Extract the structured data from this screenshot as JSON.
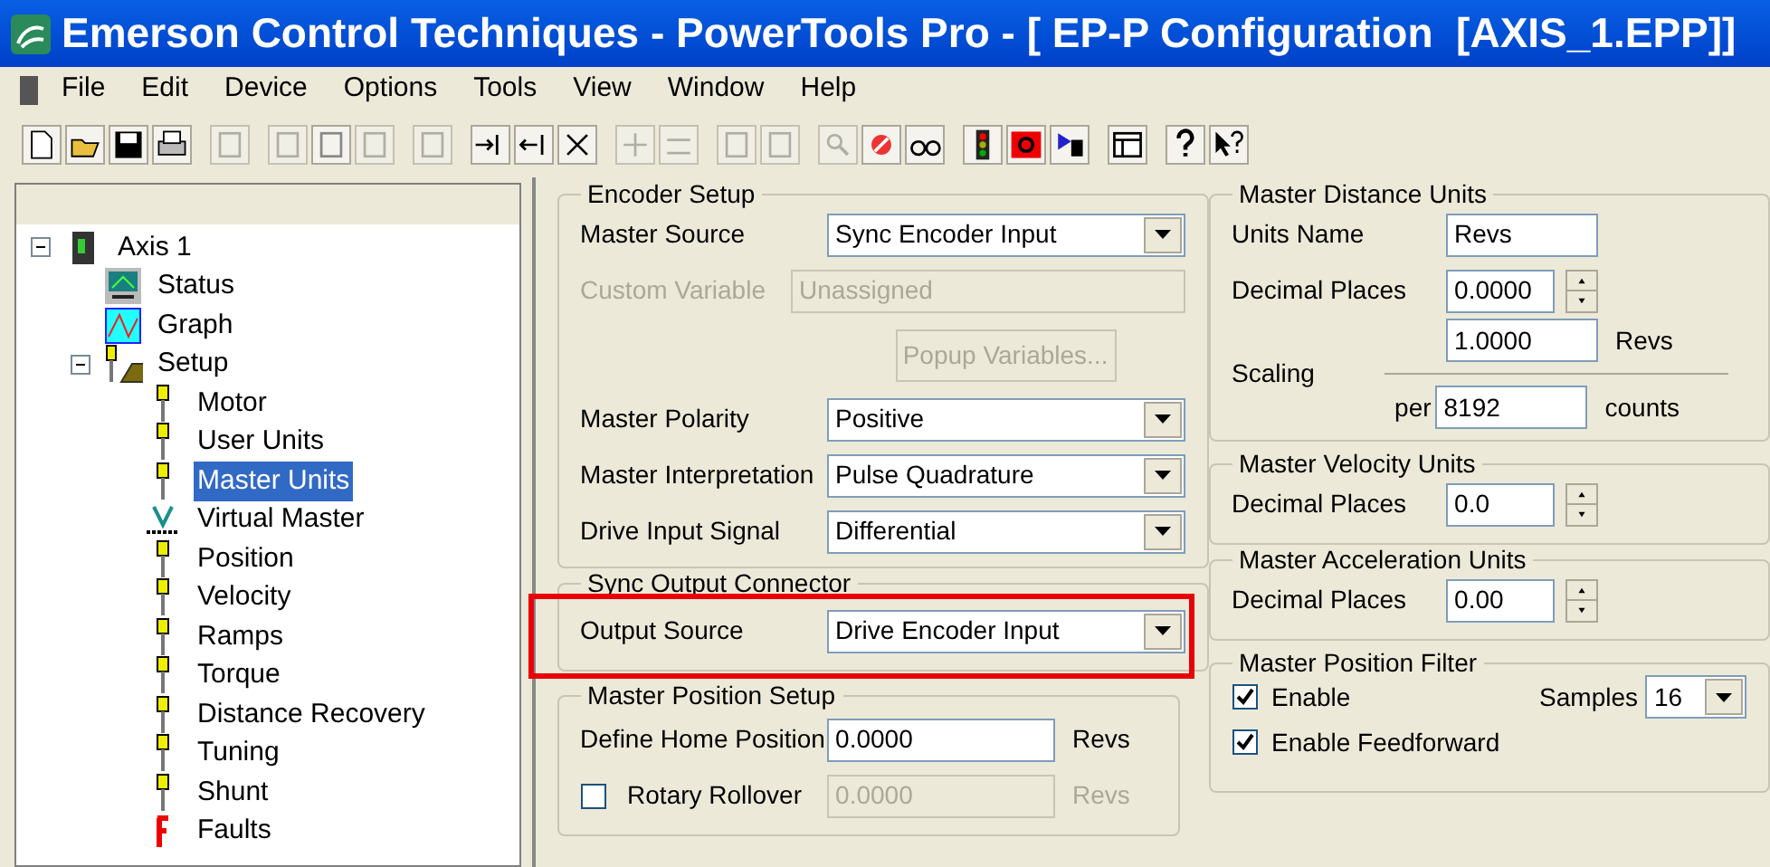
{
  "window": {
    "title": "Emerson Control Techniques - PowerTools Pro - [ EP-P Configuration  [AXIS_1.EPP]]"
  },
  "menu": [
    "File",
    "Edit",
    "Device",
    "Options",
    "Tools",
    "View",
    "Window",
    "Help"
  ],
  "tree": {
    "label": "Axis 1",
    "kind": "drive",
    "expanded": true,
    "selected": false,
    "children": [
      {
        "label": "Status",
        "kind": "status",
        "selected": false
      },
      {
        "label": "Graph",
        "kind": "graph",
        "selected": false
      },
      {
        "label": "Setup",
        "kind": "setup",
        "expanded": true,
        "selected": false,
        "children": [
          {
            "label": "Motor",
            "kind": "param",
            "selected": false
          },
          {
            "label": "User Units",
            "kind": "param",
            "selected": false
          },
          {
            "label": "Master Units",
            "kind": "param",
            "selected": true
          },
          {
            "label": "Virtual Master",
            "kind": "virtual",
            "selected": false
          },
          {
            "label": "Position",
            "kind": "param",
            "selected": false
          },
          {
            "label": "Velocity",
            "kind": "param",
            "selected": false
          },
          {
            "label": "Ramps",
            "kind": "param",
            "selected": false
          },
          {
            "label": "Torque",
            "kind": "param",
            "selected": false
          },
          {
            "label": "Distance Recovery",
            "kind": "param",
            "selected": false
          },
          {
            "label": "Tuning",
            "kind": "param",
            "selected": false
          },
          {
            "label": "Shunt",
            "kind": "param",
            "selected": false
          },
          {
            "label": "Faults",
            "kind": "fault",
            "selected": false
          }
        ]
      }
    ]
  },
  "encoder_setup": {
    "title": "Encoder Setup",
    "rows": [
      {
        "kind": "dropdown",
        "label": "Master Source",
        "value": "Sync Encoder Input",
        "disabled": false
      },
      {
        "kind": "text",
        "label": "Custom Variable",
        "value": "Unassigned",
        "disabled": true
      },
      {
        "kind": "button",
        "label": "Popup Variables...",
        "disabled": true
      },
      {
        "kind": "dropdown",
        "label": "Master Polarity",
        "value": "Positive",
        "disabled": false
      },
      {
        "kind": "dropdown",
        "label": "Master Interpretation",
        "value": "Pulse Quadrature",
        "disabled": false
      },
      {
        "kind": "dropdown",
        "label": "Drive Input Signal",
        "value": "Differential",
        "disabled": false
      }
    ]
  },
  "sync_output": {
    "title": "Sync Output Connector",
    "highlighted": true,
    "rows": [
      {
        "kind": "dropdown",
        "label": "Output Source",
        "value": "Drive Encoder Input",
        "disabled": false
      }
    ]
  },
  "position_setup": {
    "title": "Master Position Setup",
    "rows": [
      {
        "kind": "text",
        "label": "Define Home Position",
        "value": "0.0000",
        "unit": "Revs",
        "disabled": false
      },
      {
        "kind": "check_text",
        "label": "Rotary Rollover",
        "checked": false,
        "value": "0.0000",
        "unit": "Revs",
        "disabled": true
      }
    ]
  },
  "distance_units": {
    "title": "Master Distance Units",
    "units_name": {
      "label": "Units Name",
      "value": "Revs"
    },
    "decimal_places": {
      "label": "Decimal Places",
      "value": "0.0000"
    },
    "scaling": {
      "label": "Scaling",
      "numerator": "1.0000",
      "numerator_unit": "Revs",
      "per_label": "per",
      "denominator": "8192",
      "denominator_unit": "counts"
    }
  },
  "velocity_units": {
    "title": "Master Velocity Units",
    "decimal_places": {
      "label": "Decimal Places",
      "value": "0.0"
    }
  },
  "acceleration_units": {
    "title": "Master Acceleration Units",
    "decimal_places": {
      "label": "Decimal Places",
      "value": "0.00"
    }
  },
  "position_filter": {
    "title": "Master Position Filter",
    "enable": {
      "label": "Enable",
      "checked": true
    },
    "samples": {
      "label": "Samples",
      "value": "16"
    },
    "feedforward": {
      "label": "Enable Feedforward",
      "checked": true
    }
  }
}
